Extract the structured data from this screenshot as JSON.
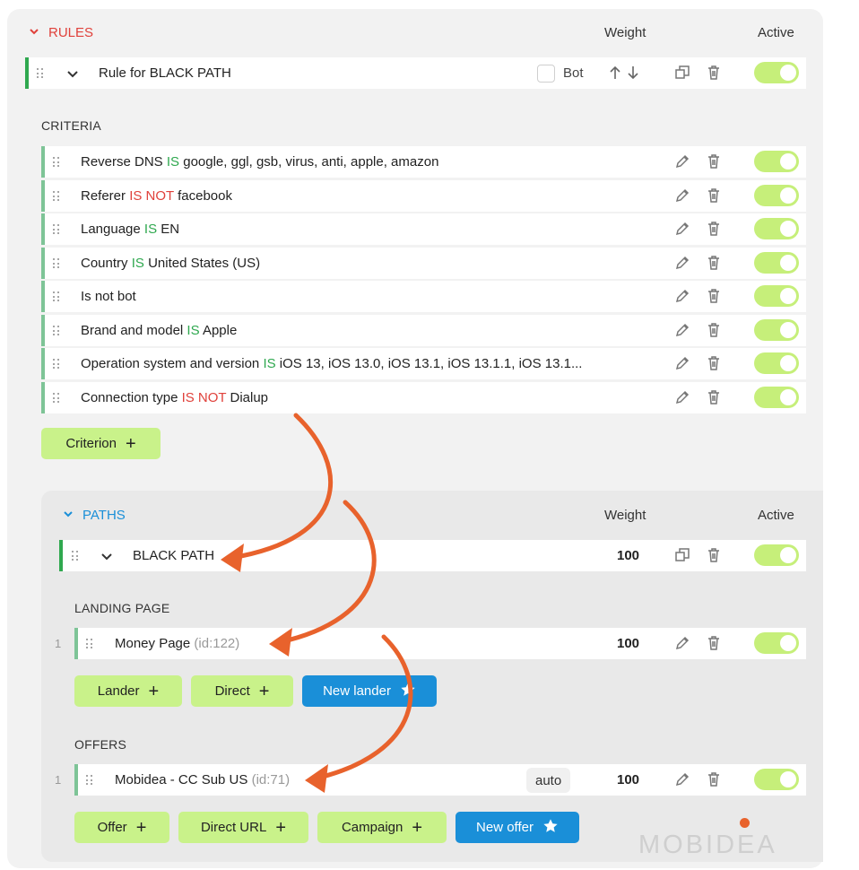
{
  "rules": {
    "title": "RULES",
    "weight_header": "Weight",
    "active_header": "Active",
    "rule_name": "Rule for BLACK PATH",
    "bot_label": "Bot",
    "criteria_heading": "CRITERIA",
    "criteria": [
      {
        "field": "Reverse DNS",
        "op": "IS",
        "value": "google, ggl, gsb, virus, anti, apple, amazon"
      },
      {
        "field": "Referer",
        "op": "IS NOT",
        "value": "facebook"
      },
      {
        "field": "Language",
        "op": "IS",
        "value": "EN"
      },
      {
        "field": "Country",
        "op": "IS",
        "value": "United States (US)"
      },
      {
        "field": "Is not bot",
        "op": "",
        "value": ""
      },
      {
        "field": "Brand and model",
        "op": "IS",
        "value": "Apple"
      },
      {
        "field": "Operation system and version",
        "op": "IS",
        "value": "iOS 13, iOS 13.0, iOS 13.1, iOS 13.1.1, iOS 13.1..."
      },
      {
        "field": "Connection type",
        "op": "IS NOT",
        "value": "Dialup"
      }
    ],
    "add_criterion_label": "Criterion"
  },
  "paths": {
    "title": "PATHS",
    "weight_header": "Weight",
    "active_header": "Active",
    "path_name": "BLACK PATH",
    "path_weight": "100",
    "landing_heading": "LANDING PAGE",
    "lander": {
      "index": "1",
      "name": "Money Page",
      "id": "(id:122)",
      "weight": "100"
    },
    "lander_buttons": {
      "lander": "Lander",
      "direct": "Direct",
      "new_lander": "New lander"
    },
    "offers_heading": "OFFERS",
    "offer": {
      "index": "1",
      "name": "Mobidea - CC Sub US",
      "id": "(id:71)",
      "mode": "auto",
      "weight": "100"
    },
    "offer_buttons": {
      "offer": "Offer",
      "direct_url": "Direct URL",
      "campaign": "Campaign",
      "new_offer": "New offer"
    }
  },
  "watermark": {
    "text": "MOBIDEA"
  },
  "colors": {
    "accent_red": "#e0413b",
    "accent_blue": "#1a8fd8",
    "is_green": "#2fa84f",
    "toggle_green": "#c6ef7a",
    "button_green": "#c9f28a",
    "annotation_orange": "#e8622c"
  }
}
